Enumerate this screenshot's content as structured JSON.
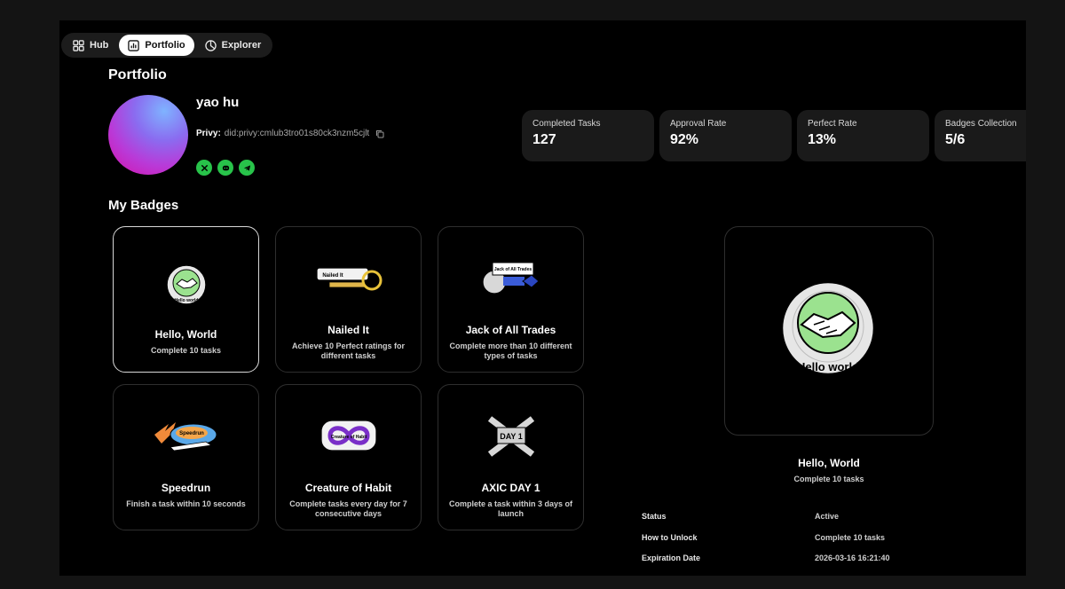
{
  "nav": {
    "items": [
      {
        "label": "Hub",
        "icon": "grid-icon"
      },
      {
        "label": "Portfolio",
        "icon": "chart-icon",
        "active": true
      },
      {
        "label": "Explorer",
        "icon": "pie-icon"
      }
    ]
  },
  "page": {
    "title": "Portfolio"
  },
  "profile": {
    "username": "yao hu",
    "privy_label": "Privy:",
    "privy_value": "did:privy:cmlub3tro01s80ck3nzm5cjlt",
    "socials": [
      "x-icon",
      "discord-icon",
      "telegram-icon"
    ]
  },
  "stats": [
    {
      "label": "Completed Tasks",
      "value": "127"
    },
    {
      "label": "Approval Rate",
      "value": "92%"
    },
    {
      "label": "Perfect Rate",
      "value": "13%"
    },
    {
      "label": "Badges Collection",
      "value": "5/6"
    }
  ],
  "badges": {
    "title": "My Badges",
    "items": [
      {
        "name": "Hello, World",
        "desc": "Complete 10 tasks",
        "art_text": "Hello world"
      },
      {
        "name": "Nailed It",
        "desc": "Achieve 10 Perfect ratings for different tasks",
        "art_text": "Nailed It"
      },
      {
        "name": "Jack of All Trades",
        "desc": "Complete more than 10 different types of tasks",
        "art_text": "Jack of All Trades"
      },
      {
        "name": "Speedrun",
        "desc": "Finish a task within 10 seconds",
        "art_text": "Speedrun"
      },
      {
        "name": "Creature of Habit",
        "desc": "Complete tasks every day for 7 consecutive days",
        "art_text": "Creature of Habit"
      },
      {
        "name": "AXIC DAY 1",
        "desc": "Complete a task within 3 days of launch",
        "art_text": "DAY 1"
      }
    ]
  },
  "detail": {
    "name": "Hello, World",
    "desc": "Complete 10 tasks",
    "art_text": "Hello world",
    "rows": [
      {
        "key": "Status",
        "value": "Active"
      },
      {
        "key": "How to Unlock",
        "value": "Complete 10 tasks"
      },
      {
        "key": "Expiration Date",
        "value": "2026-03-16 16:21:40"
      }
    ]
  }
}
